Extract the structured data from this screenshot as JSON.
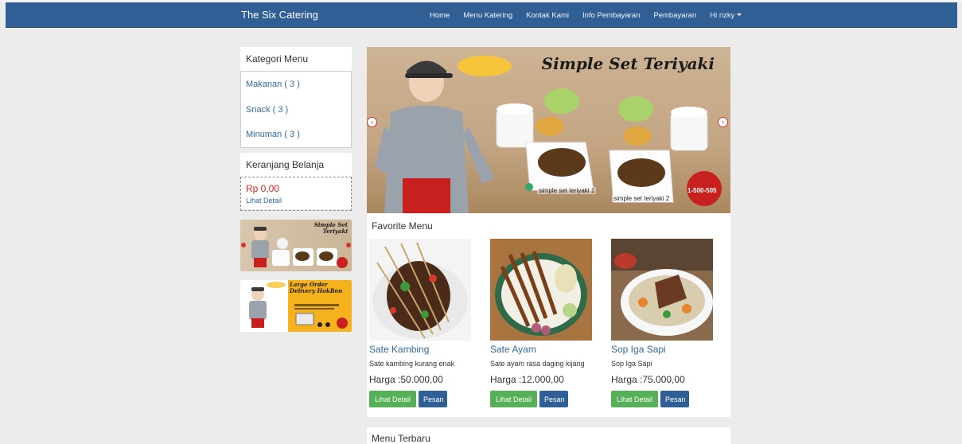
{
  "navbar": {
    "brand": "The Six Catering",
    "links": [
      "Home",
      "Menu Katering",
      "Kontak Kami",
      "Info Pembayaran",
      "Pembayaran"
    ],
    "user_label": "Hi rizky"
  },
  "sidebar": {
    "category_title": "Kategori Menu",
    "categories": [
      "Makanan ( 3 )",
      "Snack ( 3 )",
      "Minuman ( 3 )"
    ],
    "cart_title": "Keranjang Belanja",
    "cart_total": "Rp 0,00",
    "cart_link": "Lihat Detail"
  },
  "ads": {
    "ad1_title": "Simple Set Teriyaki",
    "ad2_title": "Large Order Delivery HokBen"
  },
  "slider": {
    "title": "Simple Set Teriyaki",
    "caption1": "simple set teriyaki 1",
    "caption2": "simple set teriyaki 2",
    "badge": "1-500-505",
    "prev": "‹",
    "next": "›"
  },
  "favorite": {
    "title": "Favorite Menu",
    "items": [
      {
        "name": "Sate Kambing",
        "desc": "Sate kambing kurang enak",
        "price": "Harga :50.000,00"
      },
      {
        "name": "Sate Ayam",
        "desc": "Sate ayam rasa daging kijang",
        "price": "Harga :12.000,00"
      },
      {
        "name": "Sop Iga Sapi",
        "desc": "Sop Iga Sapi",
        "price": "Harga :75.000,00"
      }
    ],
    "detail_label": "Lihat Detail",
    "order_label": "Pesan"
  },
  "latest": {
    "title": "Menu Terbaru"
  },
  "colors": {
    "navbar": "#2f5f95",
    "link": "#2f6aa6",
    "price_red": "#d9231d",
    "btn_green": "#55b058"
  }
}
